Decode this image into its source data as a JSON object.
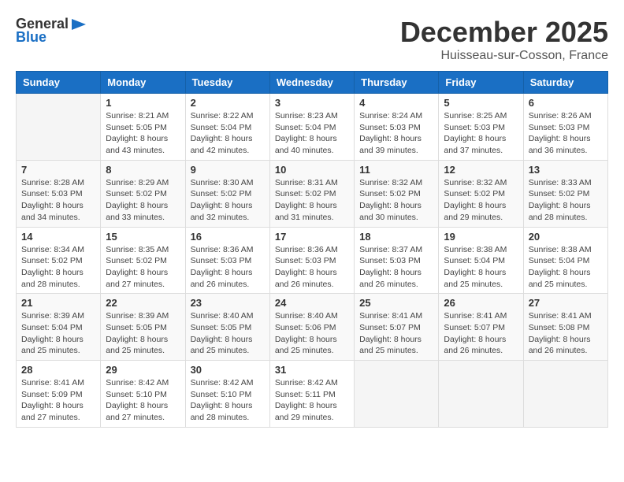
{
  "logo": {
    "general": "General",
    "blue": "Blue"
  },
  "title": "December 2025",
  "location": "Huisseau-sur-Cosson, France",
  "headers": [
    "Sunday",
    "Monday",
    "Tuesday",
    "Wednesday",
    "Thursday",
    "Friday",
    "Saturday"
  ],
  "weeks": [
    [
      {
        "day": "",
        "info": ""
      },
      {
        "day": "1",
        "info": "Sunrise: 8:21 AM\nSunset: 5:05 PM\nDaylight: 8 hours\nand 43 minutes."
      },
      {
        "day": "2",
        "info": "Sunrise: 8:22 AM\nSunset: 5:04 PM\nDaylight: 8 hours\nand 42 minutes."
      },
      {
        "day": "3",
        "info": "Sunrise: 8:23 AM\nSunset: 5:04 PM\nDaylight: 8 hours\nand 40 minutes."
      },
      {
        "day": "4",
        "info": "Sunrise: 8:24 AM\nSunset: 5:03 PM\nDaylight: 8 hours\nand 39 minutes."
      },
      {
        "day": "5",
        "info": "Sunrise: 8:25 AM\nSunset: 5:03 PM\nDaylight: 8 hours\nand 37 minutes."
      },
      {
        "day": "6",
        "info": "Sunrise: 8:26 AM\nSunset: 5:03 PM\nDaylight: 8 hours\nand 36 minutes."
      }
    ],
    [
      {
        "day": "7",
        "info": "Sunrise: 8:28 AM\nSunset: 5:03 PM\nDaylight: 8 hours\nand 34 minutes."
      },
      {
        "day": "8",
        "info": "Sunrise: 8:29 AM\nSunset: 5:02 PM\nDaylight: 8 hours\nand 33 minutes."
      },
      {
        "day": "9",
        "info": "Sunrise: 8:30 AM\nSunset: 5:02 PM\nDaylight: 8 hours\nand 32 minutes."
      },
      {
        "day": "10",
        "info": "Sunrise: 8:31 AM\nSunset: 5:02 PM\nDaylight: 8 hours\nand 31 minutes."
      },
      {
        "day": "11",
        "info": "Sunrise: 8:32 AM\nSunset: 5:02 PM\nDaylight: 8 hours\nand 30 minutes."
      },
      {
        "day": "12",
        "info": "Sunrise: 8:32 AM\nSunset: 5:02 PM\nDaylight: 8 hours\nand 29 minutes."
      },
      {
        "day": "13",
        "info": "Sunrise: 8:33 AM\nSunset: 5:02 PM\nDaylight: 8 hours\nand 28 minutes."
      }
    ],
    [
      {
        "day": "14",
        "info": "Sunrise: 8:34 AM\nSunset: 5:02 PM\nDaylight: 8 hours\nand 28 minutes."
      },
      {
        "day": "15",
        "info": "Sunrise: 8:35 AM\nSunset: 5:02 PM\nDaylight: 8 hours\nand 27 minutes."
      },
      {
        "day": "16",
        "info": "Sunrise: 8:36 AM\nSunset: 5:03 PM\nDaylight: 8 hours\nand 26 minutes."
      },
      {
        "day": "17",
        "info": "Sunrise: 8:36 AM\nSunset: 5:03 PM\nDaylight: 8 hours\nand 26 minutes."
      },
      {
        "day": "18",
        "info": "Sunrise: 8:37 AM\nSunset: 5:03 PM\nDaylight: 8 hours\nand 26 minutes."
      },
      {
        "day": "19",
        "info": "Sunrise: 8:38 AM\nSunset: 5:04 PM\nDaylight: 8 hours\nand 25 minutes."
      },
      {
        "day": "20",
        "info": "Sunrise: 8:38 AM\nSunset: 5:04 PM\nDaylight: 8 hours\nand 25 minutes."
      }
    ],
    [
      {
        "day": "21",
        "info": "Sunrise: 8:39 AM\nSunset: 5:04 PM\nDaylight: 8 hours\nand 25 minutes."
      },
      {
        "day": "22",
        "info": "Sunrise: 8:39 AM\nSunset: 5:05 PM\nDaylight: 8 hours\nand 25 minutes."
      },
      {
        "day": "23",
        "info": "Sunrise: 8:40 AM\nSunset: 5:05 PM\nDaylight: 8 hours\nand 25 minutes."
      },
      {
        "day": "24",
        "info": "Sunrise: 8:40 AM\nSunset: 5:06 PM\nDaylight: 8 hours\nand 25 minutes."
      },
      {
        "day": "25",
        "info": "Sunrise: 8:41 AM\nSunset: 5:07 PM\nDaylight: 8 hours\nand 25 minutes."
      },
      {
        "day": "26",
        "info": "Sunrise: 8:41 AM\nSunset: 5:07 PM\nDaylight: 8 hours\nand 26 minutes."
      },
      {
        "day": "27",
        "info": "Sunrise: 8:41 AM\nSunset: 5:08 PM\nDaylight: 8 hours\nand 26 minutes."
      }
    ],
    [
      {
        "day": "28",
        "info": "Sunrise: 8:41 AM\nSunset: 5:09 PM\nDaylight: 8 hours\nand 27 minutes."
      },
      {
        "day": "29",
        "info": "Sunrise: 8:42 AM\nSunset: 5:10 PM\nDaylight: 8 hours\nand 27 minutes."
      },
      {
        "day": "30",
        "info": "Sunrise: 8:42 AM\nSunset: 5:10 PM\nDaylight: 8 hours\nand 28 minutes."
      },
      {
        "day": "31",
        "info": "Sunrise: 8:42 AM\nSunset: 5:11 PM\nDaylight: 8 hours\nand 29 minutes."
      },
      {
        "day": "",
        "info": ""
      },
      {
        "day": "",
        "info": ""
      },
      {
        "day": "",
        "info": ""
      }
    ]
  ]
}
